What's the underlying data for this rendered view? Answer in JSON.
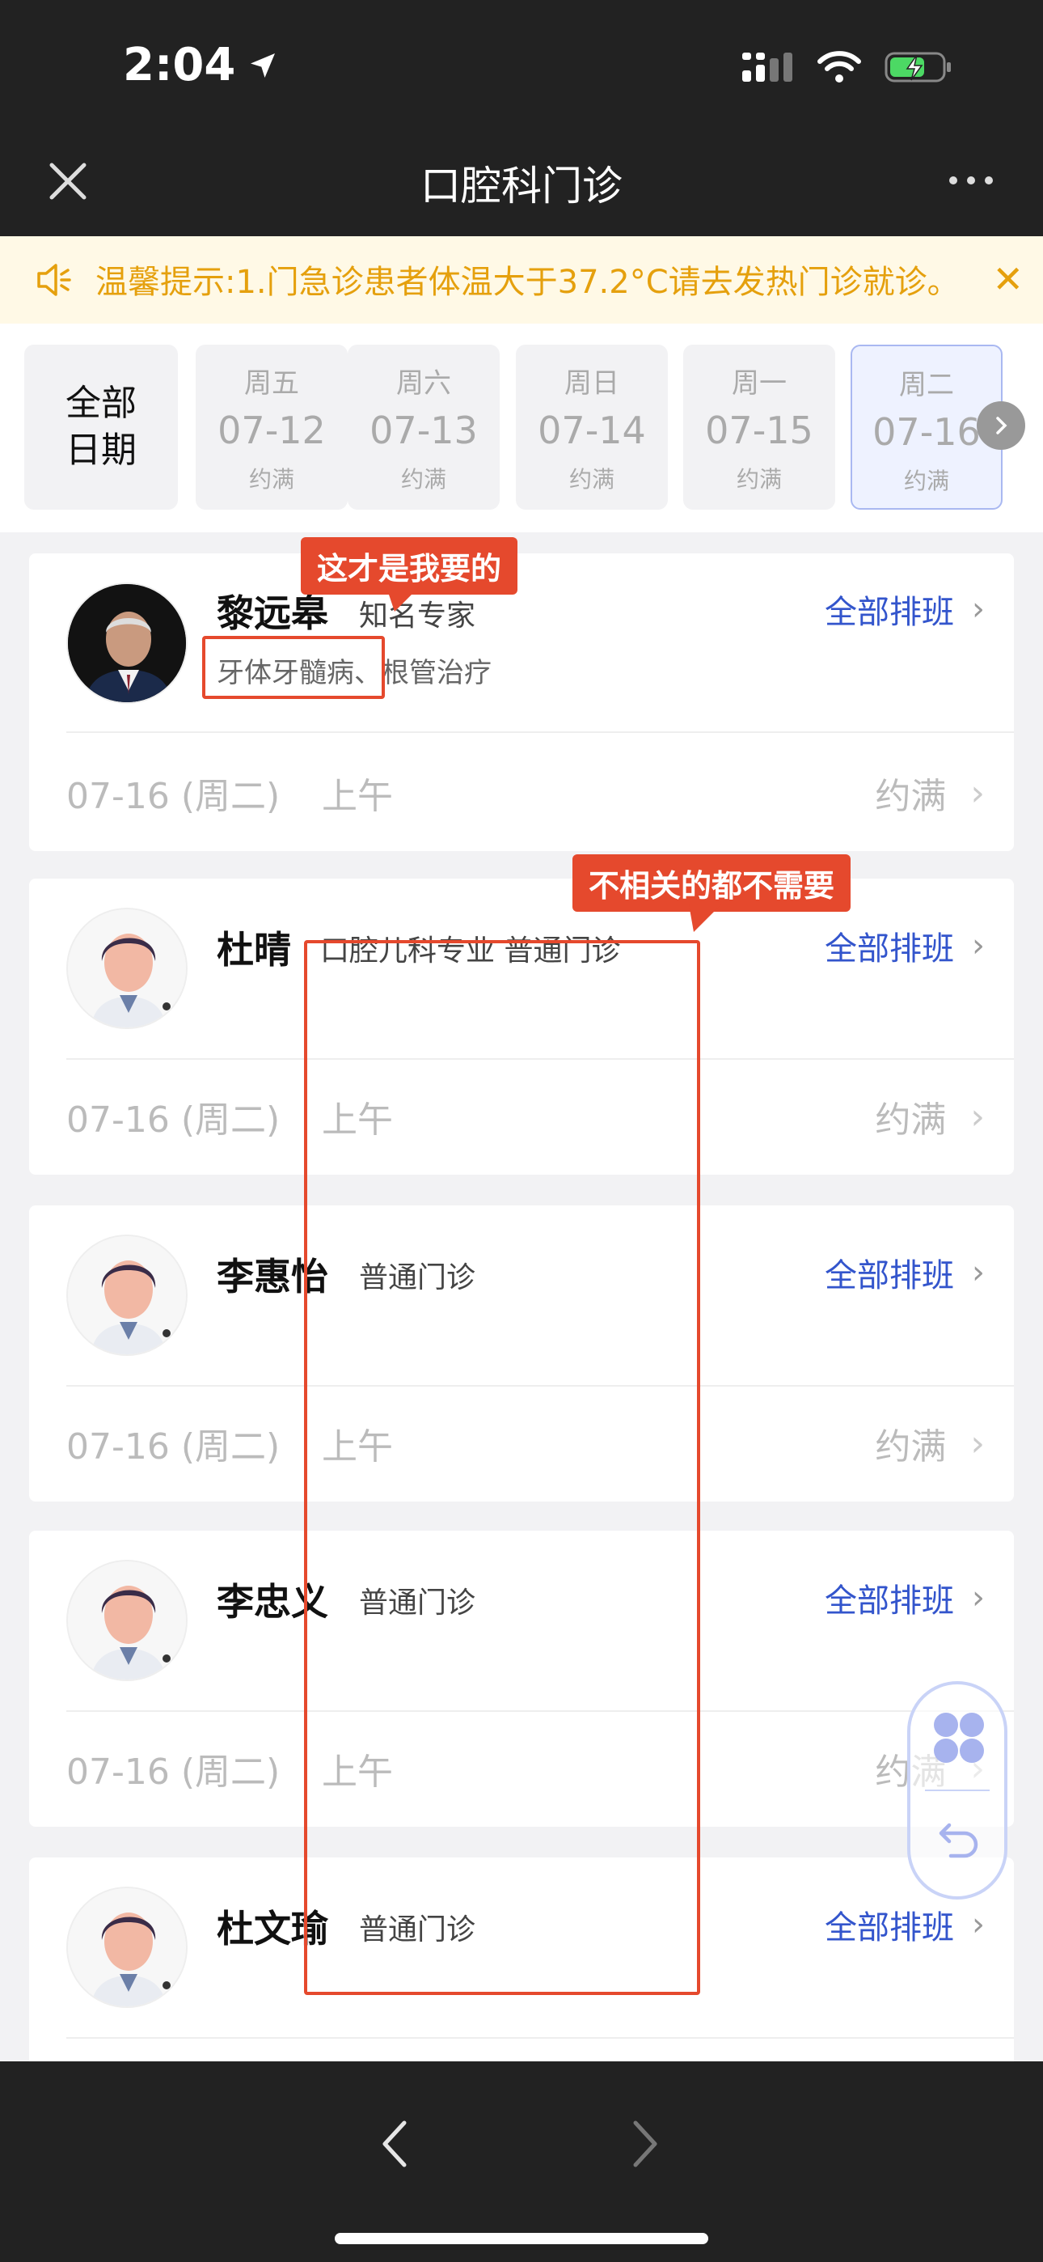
{
  "status": {
    "time": "2:04"
  },
  "nav": {
    "title": "口腔科门诊"
  },
  "notice": {
    "text": "温馨提示:1.门急诊患者体温大于37.2°C请去发热门诊就诊。",
    "close": "✕"
  },
  "dates": {
    "all_line1": "全部",
    "all_line2": "日期",
    "days": [
      {
        "weekday": "周五",
        "date": "07-12",
        "status": "约满"
      },
      {
        "weekday": "周六",
        "date": "07-13",
        "status": "约满"
      },
      {
        "weekday": "周日",
        "date": "07-14",
        "status": "约满"
      },
      {
        "weekday": "周一",
        "date": "07-15",
        "status": "约满"
      },
      {
        "weekday": "周二",
        "date": "07-16",
        "status": "约满"
      }
    ]
  },
  "doctors": [
    {
      "name": "黎远皋",
      "title": "知名专家",
      "skills": "牙体牙髓病、根管治疗",
      "schedule_label": "全部排班",
      "slot_date": "07-16 (周二)",
      "slot_period": "上午",
      "slot_status": "约满"
    },
    {
      "name": "杜晴",
      "title": "口腔儿科专业 普通门诊",
      "skills": "",
      "schedule_label": "全部排班",
      "slot_date": "07-16 (周二)",
      "slot_period": "上午",
      "slot_status": "约满"
    },
    {
      "name": "李惠怡",
      "title": "普通门诊",
      "skills": "",
      "schedule_label": "全部排班",
      "slot_date": "07-16 (周二)",
      "slot_period": "上午",
      "slot_status": "约满"
    },
    {
      "name": "李忠义",
      "title": "普通门诊",
      "skills": "",
      "schedule_label": "全部排班",
      "slot_date": "07-16 (周二)",
      "slot_period": "上午",
      "slot_status": "约满"
    },
    {
      "name": "杜文瑜",
      "title": "普通门诊",
      "skills": "",
      "schedule_label": "全部排班"
    }
  ],
  "annotations": {
    "wanted": "这才是我要的",
    "unneeded": "不相关的都不需要"
  },
  "chevron": "›",
  "colors": {
    "accent": "#3355cc",
    "annotation": "#e5492d",
    "notice": "#e5a00d",
    "bar": "#222222"
  }
}
